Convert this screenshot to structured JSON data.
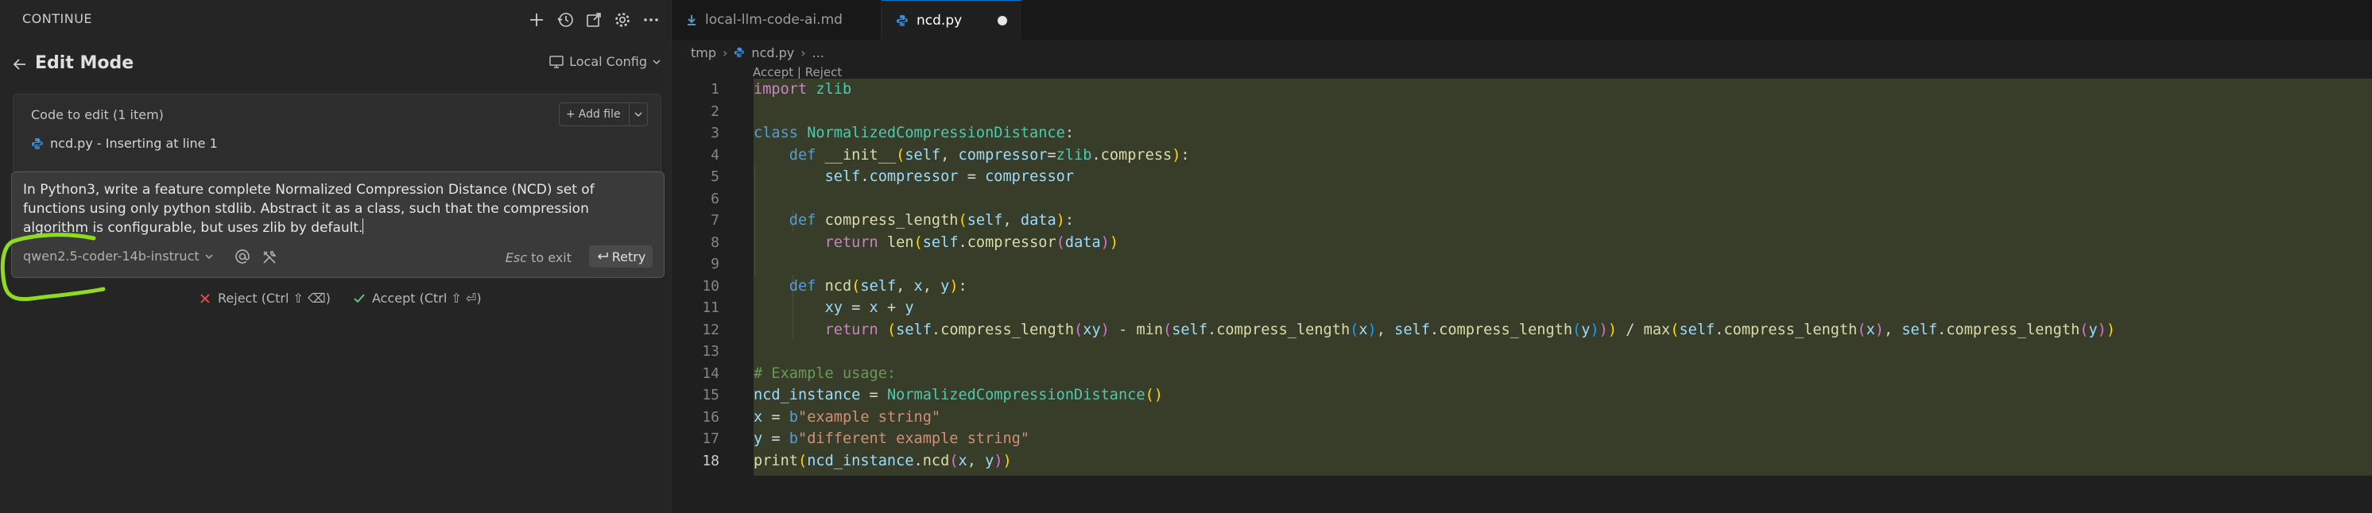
{
  "sidebar": {
    "header_title": "CONTINUE",
    "header_icons": [
      "plus-icon",
      "history-icon",
      "open-external-icon",
      "gear-icon",
      "more-icon"
    ],
    "mode_title": "Edit Mode",
    "config_label": "Local Config",
    "code_to_edit_label": "Code to edit (1 item)",
    "add_file_label": "Add file",
    "file_item": "ncd.py - Inserting at line 1",
    "prompt_text": "In Python3, write a feature complete Normalized Compression Distance (NCD) set of functions using only python stdlib. Abstract it as a class, such that the compression algorithm is configurable, but uses zlib by default.",
    "model_label": "qwen2.5-coder-14b-instruct",
    "esc_key": "Esc",
    "esc_text": "to exit",
    "retry_label": "Retry",
    "reject_label": "Reject (Ctrl ⇧ ⌫)",
    "accept_label": "Accept (Ctrl ⇧ ⏎)"
  },
  "editor": {
    "tabs": [
      {
        "label": "local-llm-code-ai.md",
        "active": false
      },
      {
        "label": "ncd.py",
        "active": true,
        "modified": true
      }
    ],
    "breadcrumb": [
      "tmp",
      "ncd.py",
      "..."
    ],
    "codelens": {
      "accept": "Accept",
      "separator": "|",
      "reject": "Reject"
    },
    "line_numbers": [
      "1",
      "2",
      "3",
      "4",
      "5",
      "6",
      "7",
      "8",
      "9",
      "10",
      "11",
      "12",
      "13",
      "14",
      "15",
      "16",
      "17",
      "18"
    ],
    "current_line": "18"
  },
  "colors": {
    "diff_added_bg": "#373d29",
    "active_tab_border": "#0078d4",
    "scribble": "#8fdc1f",
    "reject_x": "#f14c4c",
    "accept_check": "#73c991"
  }
}
